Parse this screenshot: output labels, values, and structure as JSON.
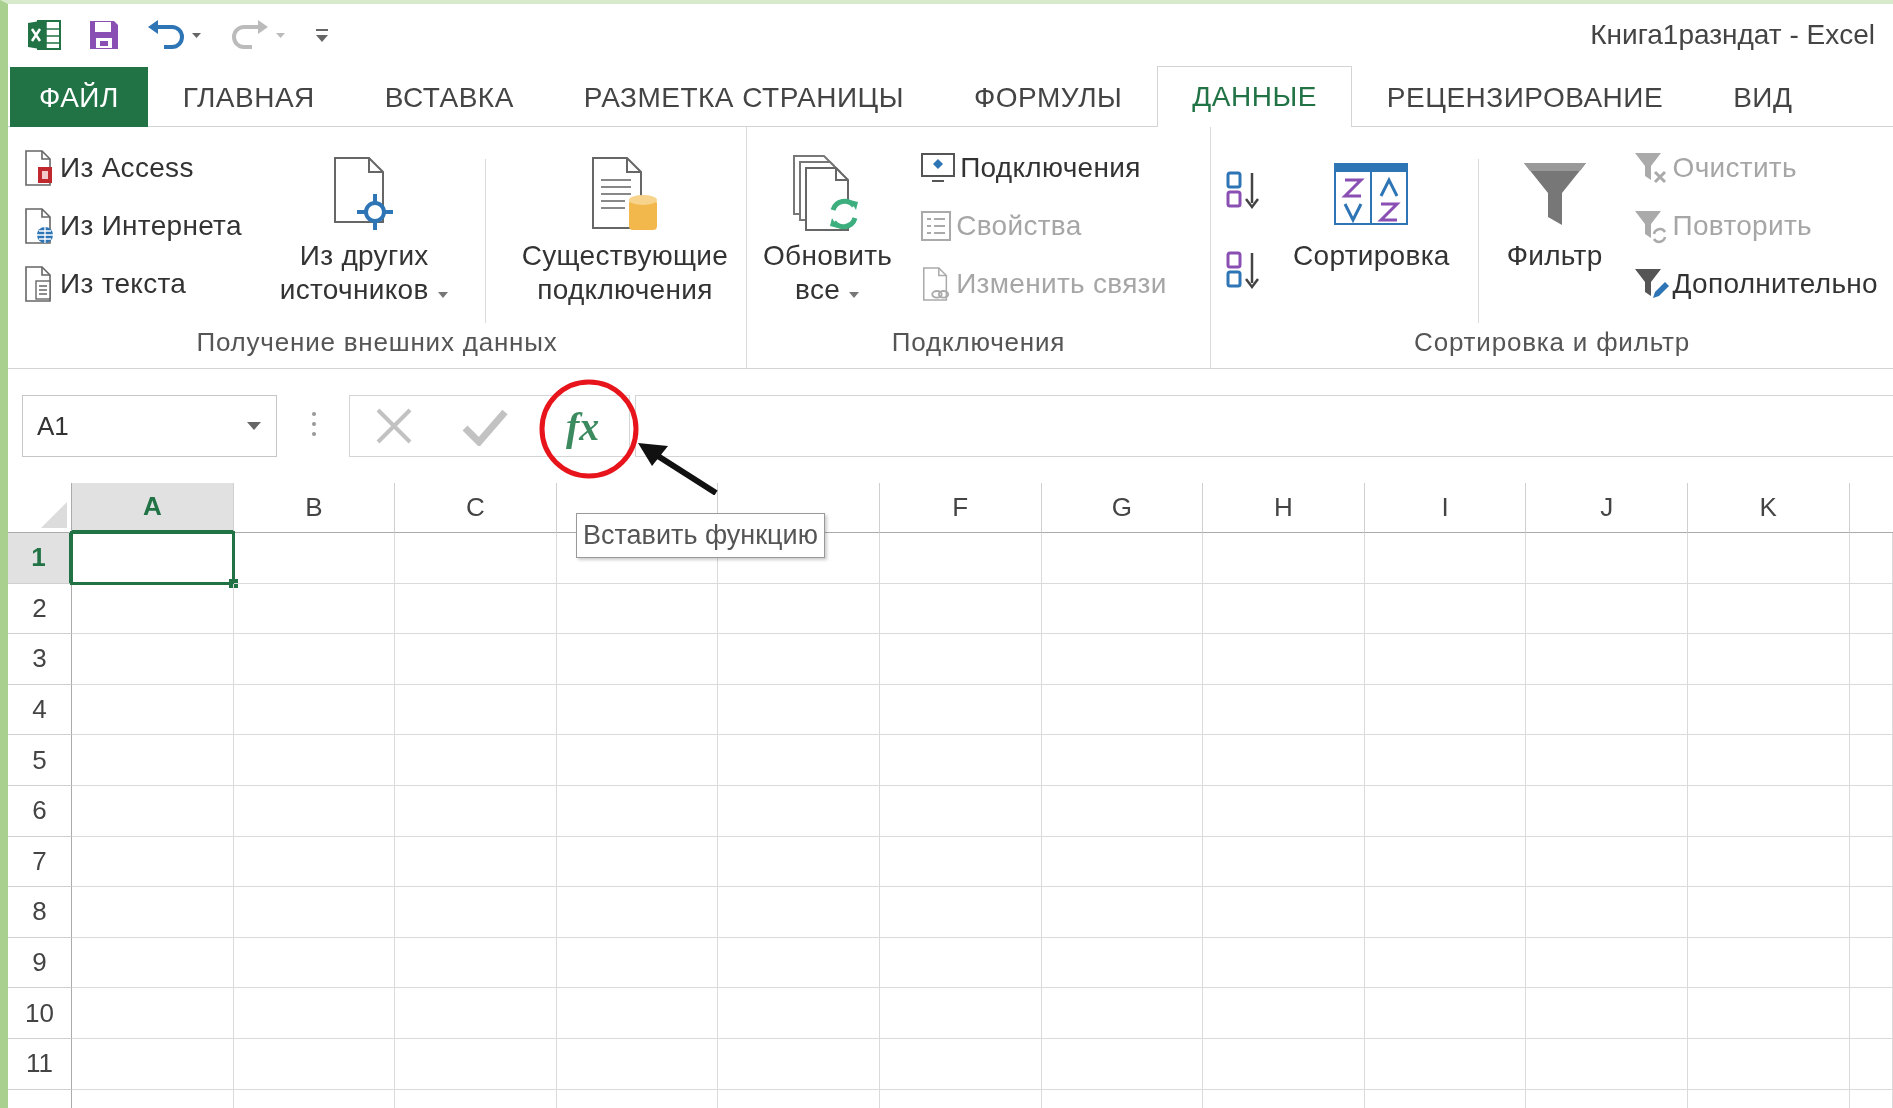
{
  "window": {
    "title": "Книга1разндат - Excel"
  },
  "tabs": [
    {
      "label": "ФАЙЛ",
      "kind": "file",
      "selected": false
    },
    {
      "label": "ГЛАВНАЯ",
      "kind": "tab",
      "selected": false
    },
    {
      "label": "ВСТАВКА",
      "kind": "tab",
      "selected": false
    },
    {
      "label": "РАЗМЕТКА СТРАНИЦЫ",
      "kind": "tab",
      "selected": false
    },
    {
      "label": "ФОРМУЛЫ",
      "kind": "tab",
      "selected": false
    },
    {
      "label": "ДАННЫЕ",
      "kind": "tab",
      "selected": true
    },
    {
      "label": "РЕЦЕНЗИРОВАНИЕ",
      "kind": "tab",
      "selected": false
    },
    {
      "label": "ВИД",
      "kind": "tab",
      "selected": false
    }
  ],
  "ribbon": {
    "groups": [
      {
        "label": "Получение внешних данных",
        "items": [
          {
            "kind": "stack",
            "buttons": [
              {
                "label": "Из Access",
                "disabled": false
              },
              {
                "label": "Из Интернета",
                "disabled": false
              },
              {
                "label": "Из текста",
                "disabled": false
              }
            ]
          },
          {
            "kind": "large",
            "label": "Из других\nисточников",
            "dropdown": true
          },
          {
            "kind": "separator"
          },
          {
            "kind": "large",
            "label": "Существующие\nподключения",
            "dropdown": false
          }
        ]
      },
      {
        "label": "Подключения",
        "items": [
          {
            "kind": "large",
            "label": "Обновить\nвсе",
            "dropdown": true
          },
          {
            "kind": "stack",
            "buttons": [
              {
                "label": "Подключения",
                "disabled": false
              },
              {
                "label": "Свойства",
                "disabled": true
              },
              {
                "label": "Изменить связи",
                "disabled": true
              }
            ]
          }
        ]
      },
      {
        "label": "Сортировка и фильтр",
        "items": [
          {
            "kind": "sort_pair"
          },
          {
            "kind": "large",
            "label": "Сортировка",
            "dropdown": false
          },
          {
            "kind": "separator"
          },
          {
            "kind": "large",
            "label": "Фильтр",
            "dropdown": false
          },
          {
            "kind": "stack",
            "buttons": [
              {
                "label": "Очистить",
                "disabled": true
              },
              {
                "label": "Повторить",
                "disabled": true
              },
              {
                "label": "Дополнительно",
                "disabled": false
              }
            ]
          }
        ]
      }
    ]
  },
  "formula_bar": {
    "name_box": "A1",
    "function_button": "fx"
  },
  "tooltip": {
    "text": "Вставить функцию"
  },
  "sheet": {
    "columns": [
      {
        "label": "A",
        "selected": true
      },
      {
        "label": "B",
        "selected": false
      },
      {
        "label": "C",
        "selected": false
      },
      {
        "selected": false
      },
      {
        "selected": false
      },
      {
        "label": "F",
        "selected": false
      },
      {
        "label": "G",
        "selected": false
      },
      {
        "label": "H",
        "selected": false
      },
      {
        "label": "I",
        "selected": false
      },
      {
        "label": "J",
        "selected": false
      },
      {
        "label": "K",
        "selected": false
      }
    ],
    "rows": [
      {
        "label": "1",
        "selected": true
      },
      {
        "label": "2",
        "selected": false
      },
      {
        "label": "3",
        "selected": false
      },
      {
        "label": "4",
        "selected": false
      },
      {
        "label": "5",
        "selected": false
      },
      {
        "label": "6",
        "selected": false
      },
      {
        "label": "7",
        "selected": false
      },
      {
        "label": "8",
        "selected": false
      },
      {
        "label": "9",
        "selected": false
      },
      {
        "label": "10",
        "selected": false
      },
      {
        "label": "11",
        "selected": false
      }
    ]
  }
}
